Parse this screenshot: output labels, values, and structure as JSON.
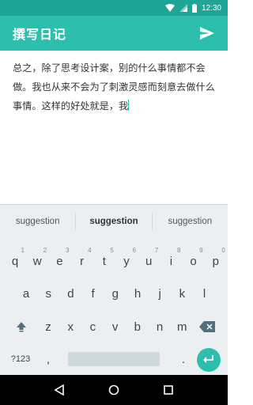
{
  "status_bar": {
    "time": "12:30"
  },
  "app_bar": {
    "title": "撰写日记"
  },
  "editor": {
    "text": "总之，除了思考设计案，别的什么事情都不会做。我也从来不会为了刺激灵感而刻意去做什么事情。这样的好处就是，我"
  },
  "keyboard": {
    "suggestions": [
      "suggestion",
      "suggestion",
      "suggestion"
    ],
    "row1": [
      {
        "k": "q",
        "h": "1"
      },
      {
        "k": "w",
        "h": "2"
      },
      {
        "k": "e",
        "h": "3"
      },
      {
        "k": "r",
        "h": "4"
      },
      {
        "k": "t",
        "h": "5"
      },
      {
        "k": "y",
        "h": "6"
      },
      {
        "k": "u",
        "h": "7"
      },
      {
        "k": "i",
        "h": "8"
      },
      {
        "k": "o",
        "h": "9"
      },
      {
        "k": "p",
        "h": "0"
      }
    ],
    "row2": [
      "a",
      "s",
      "d",
      "f",
      "g",
      "h",
      "j",
      "k",
      "l"
    ],
    "row3": [
      "z",
      "x",
      "c",
      "v",
      "b",
      "n",
      "m"
    ],
    "symbols_label": "?123",
    "comma_label": ",",
    "period_label": "."
  },
  "colors": {
    "primary": "#2cbfae",
    "status": "#1fa595"
  },
  "icons": {
    "send": "send-icon",
    "wifi": "wifi-icon",
    "signal": "signal-icon",
    "battery": "battery-icon",
    "shift": "shift-icon",
    "backspace": "backspace-icon",
    "enter": "enter-icon",
    "back": "back-icon",
    "home": "home-icon",
    "recents": "recents-icon"
  }
}
